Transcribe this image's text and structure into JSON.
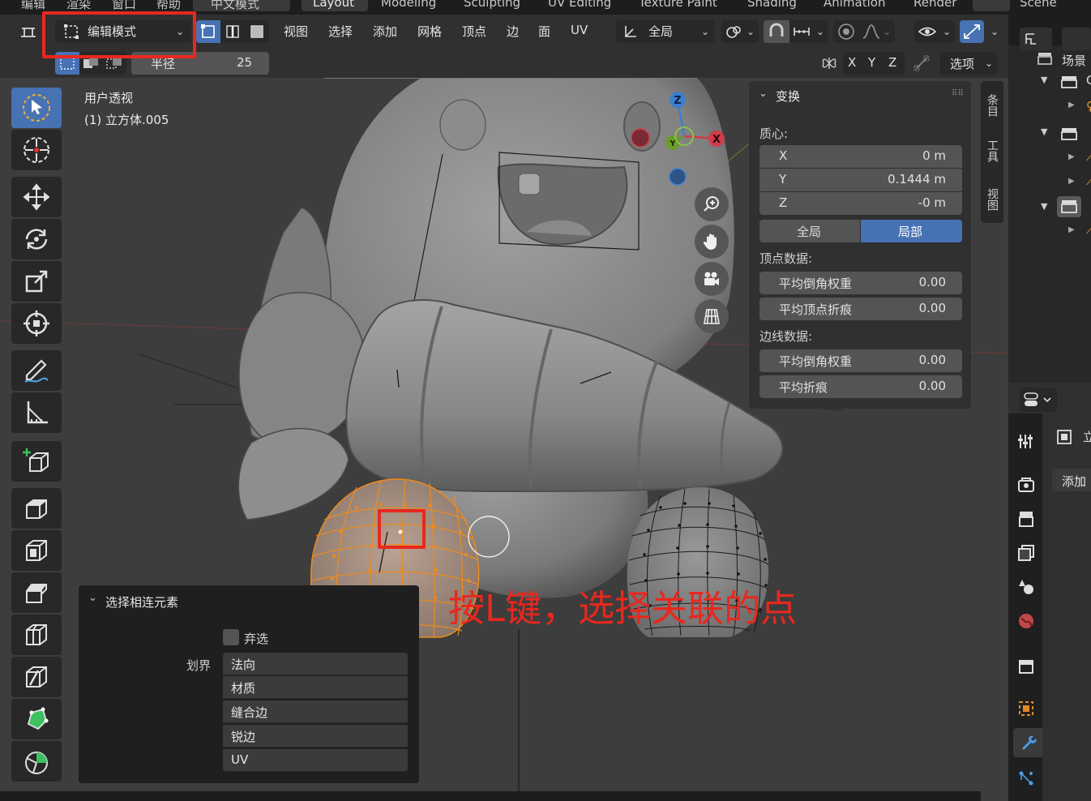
{
  "top_menu": {
    "items": [
      "编辑",
      "渲染",
      "窗口",
      "帮助",
      "中文模式"
    ]
  },
  "workspace_tabs": [
    "Layout",
    "Modeling",
    "Sculpting",
    "UV Editing",
    "Texture Paint",
    "Shading",
    "Animation",
    "Render"
  ],
  "scene_label": "Scene",
  "header": {
    "mode_label": "编辑模式",
    "menu_items": [
      "视图",
      "选择",
      "添加",
      "网格",
      "顶点",
      "边",
      "面",
      "UV"
    ],
    "transform_orientation": "全局"
  },
  "subheader": {
    "radius_label": "半径",
    "radius_value": "25",
    "axes": [
      "X",
      "Y",
      "Z"
    ],
    "options_label": "选项"
  },
  "viewport": {
    "view_name": "用户透视",
    "object_name": "(1) 立方体.005"
  },
  "gizmo": {
    "z": "Z",
    "x": "X",
    "y": "Y"
  },
  "npanel": {
    "section_title": "变换",
    "median_label": "质心:",
    "fields": [
      {
        "label": "X",
        "value": "0 m"
      },
      {
        "label": "Y",
        "value": "0.1444 m"
      },
      {
        "label": "Z",
        "value": "-0 m"
      }
    ],
    "space_global": "全局",
    "space_local": "局部",
    "vertex_data_label": "顶点数据:",
    "vertex_fields": [
      {
        "label": "平均倒角权重",
        "value": "0.00"
      },
      {
        "label": "平均顶点折痕",
        "value": "0.00"
      }
    ],
    "edge_data_label": "边线数据:",
    "edge_fields": [
      {
        "label": "平均倒角权重",
        "value": "0.00"
      },
      {
        "label": "平均折痕",
        "value": "0.00"
      }
    ]
  },
  "sidebar_tabs": [
    "条目",
    "工具",
    "视图"
  ],
  "last_operator": {
    "title": "选择相连元素",
    "deselect_label": "弃选",
    "delimit_label": "划界",
    "delimit_options": [
      "法向",
      "材质",
      "缝合边",
      "锐边",
      "UV"
    ]
  },
  "annotation": {
    "text": "按L键，选择关联的点",
    "color": "#e8281e"
  },
  "outliner": {
    "scene_collection": "场景"
  },
  "properties": {
    "add_label": "添加"
  },
  "colors": {
    "active_blue": "#4772b3",
    "selection_orange": "#f08a1a",
    "annotation_red": "#e8281e"
  }
}
